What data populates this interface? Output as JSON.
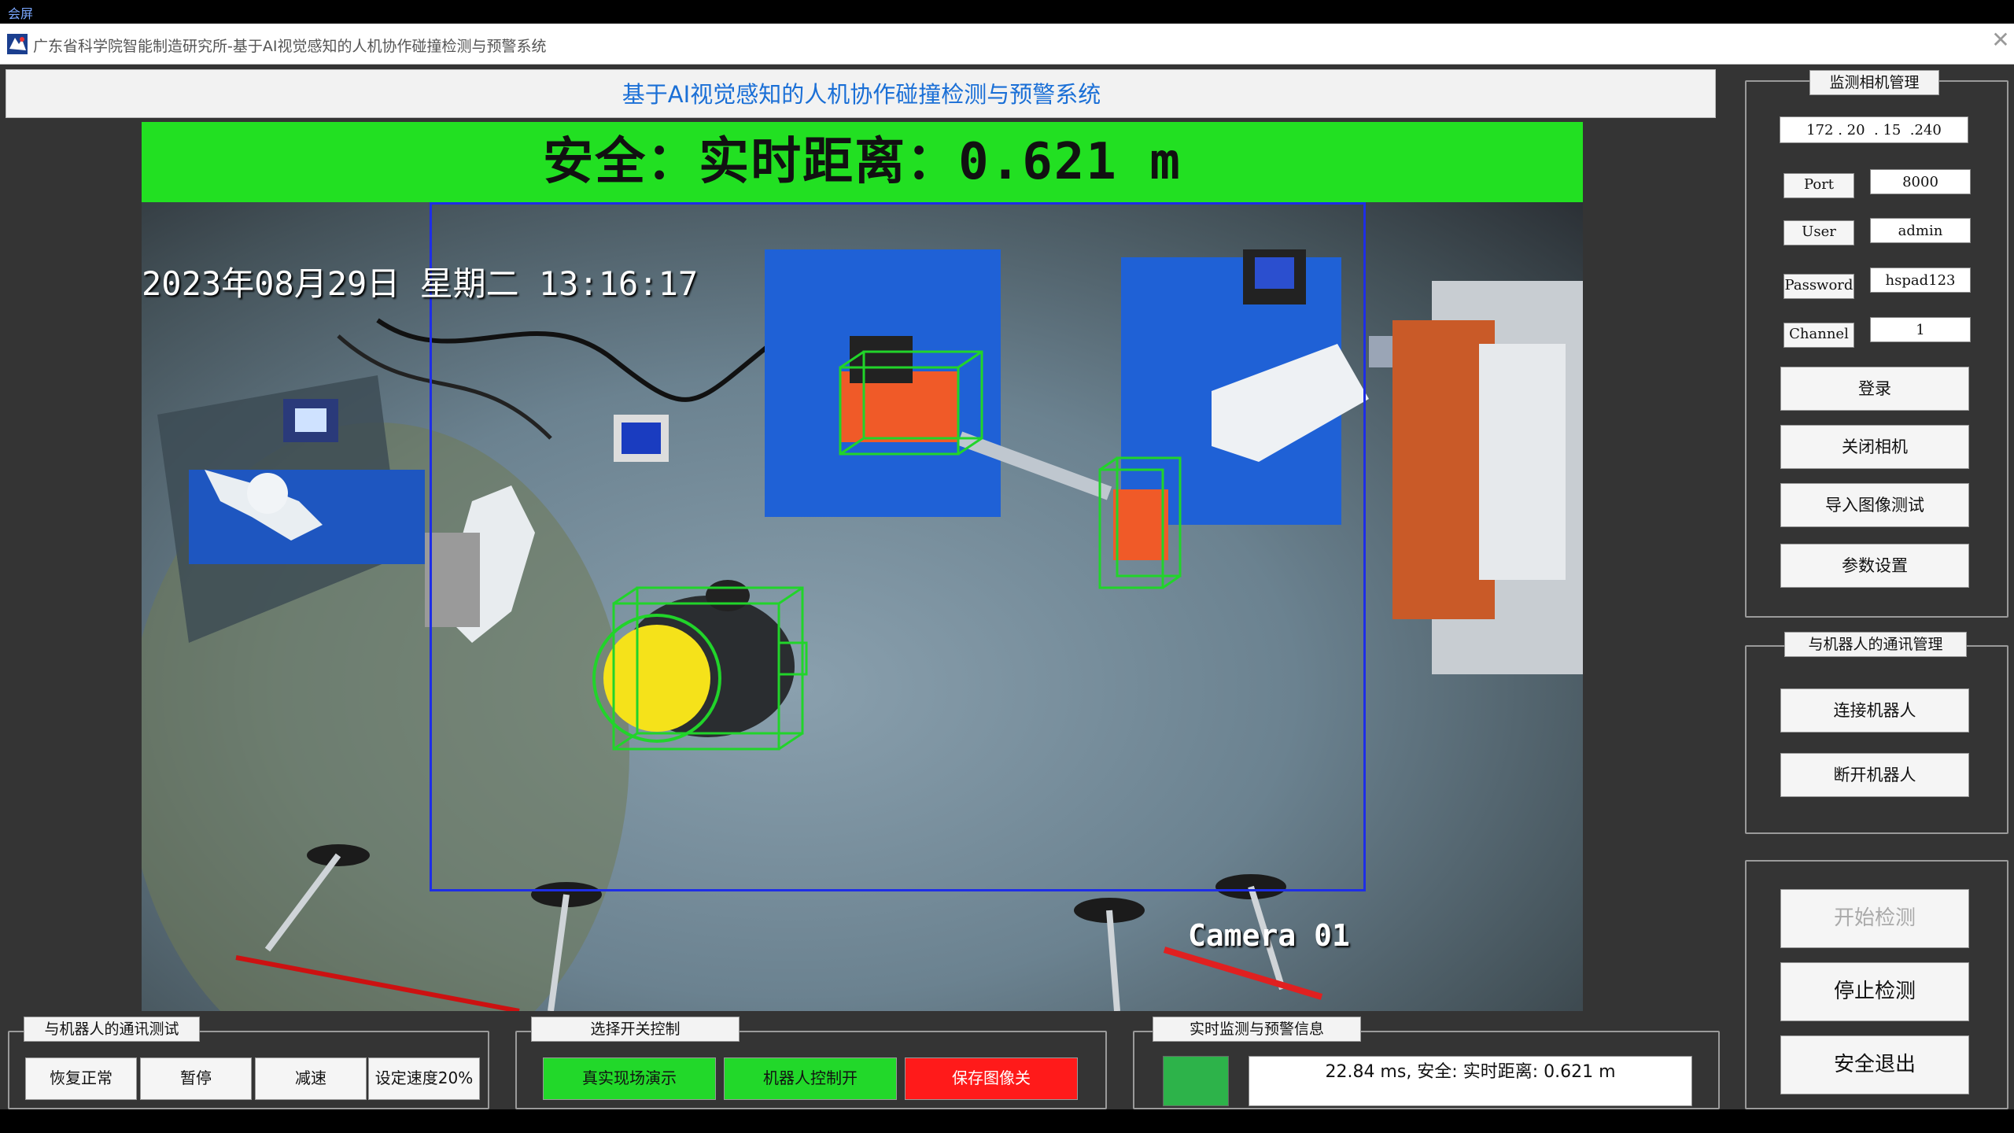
{
  "window": {
    "topstrip_text": "会屏",
    "title": "广东省科学院智能制造研究所-基于AI视觉感知的人机协作碰撞检测与预警系统"
  },
  "header": {
    "title": "基于AI视觉感知的人机协作碰撞检测与预警系统"
  },
  "video": {
    "status_text": "安全：实时距离：0.621 m",
    "timestamp": "2023年08月29日  星期二  13:16:17",
    "camera_label": "Camera 01"
  },
  "camera_panel": {
    "title": "监测相机管理",
    "ip_address": "172 . 20  . 15  .240",
    "port_label": "Port",
    "port_value": "8000",
    "user_label": "User",
    "user_value": "admin",
    "password_label": "Password",
    "password_value": "hspad123",
    "channel_label": "Channel",
    "channel_value": "1",
    "login_button": "登录",
    "close_camera_button": "关闭相机",
    "import_image_button": "导入图像测试",
    "settings_button": "参数设置"
  },
  "robot_comm_panel": {
    "title": "与机器人的通讯管理",
    "connect_button": "连接机器人",
    "disconnect_button": "断开机器人"
  },
  "detection_panel": {
    "start_button": "开始检测",
    "stop_button": "停止检测",
    "exit_button": "安全退出"
  },
  "comm_test_panel": {
    "title": "与机器人的通讯测试",
    "buttons": [
      "恢复正常",
      "暂停",
      "减速",
      "设定速度20%"
    ]
  },
  "switch_panel": {
    "title": "选择开关控制",
    "buttons": [
      "真实现场演示",
      "机器人控制开",
      "保存图像关"
    ]
  },
  "monitor_panel": {
    "title": "实时监测与预警信息",
    "info_text": "22.84 ms, 安全: 实时距离: 0.621 m"
  },
  "colors": {
    "safe_green": "#22e022",
    "indicator_green": "#2db34a",
    "alert_red": "#ff1a1a",
    "header_blue": "#1a6fd6",
    "roi_blue": "#1e2ee6",
    "detection_green": "#21d42a"
  }
}
